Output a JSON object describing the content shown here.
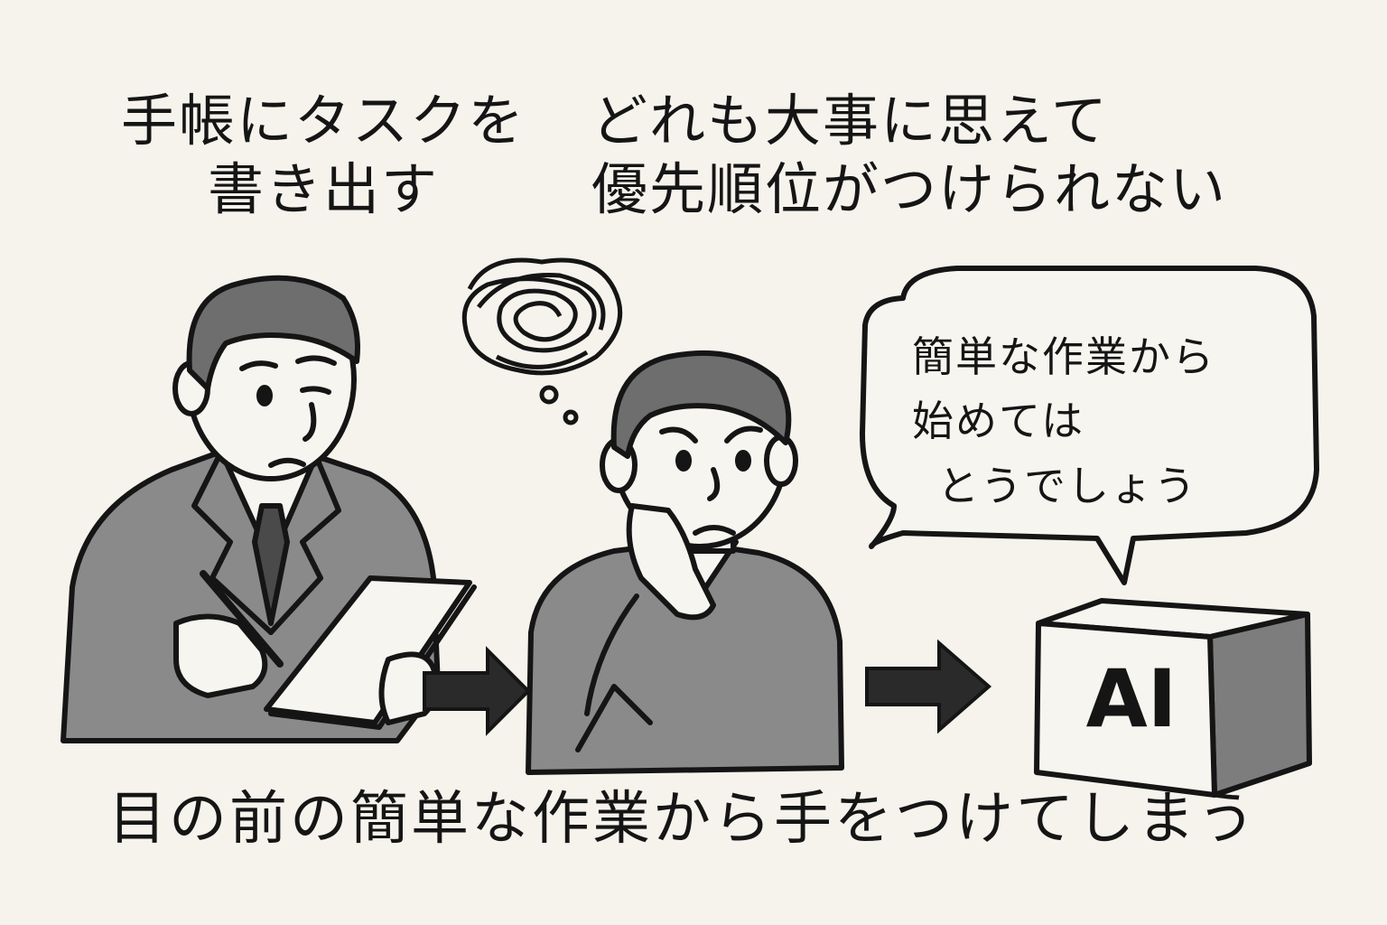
{
  "captions": {
    "step1_line1": "手帳にタスクを",
    "step1_line2": "書き出す",
    "step2_line1": "どれも大事に思えて",
    "step2_line2": "優先順位がつけられない",
    "bottom": "目の前の簡単な作業から手をつけてしまう"
  },
  "speech_bubble": {
    "line1": "簡単な作業から",
    "line2": "始めては",
    "line3": "とうでしょう"
  },
  "ai_box": {
    "label": "AI"
  },
  "colors": {
    "background": "#f5f3ec",
    "ink": "#151515",
    "suit": "#8a8a8a",
    "hair": "#6e6e6e",
    "skin": "#f7f5ef",
    "box_side": "#7d7d7d"
  },
  "icons": [
    "confused-scribble-icon",
    "right-arrow-icon",
    "ai-cube-icon"
  ]
}
